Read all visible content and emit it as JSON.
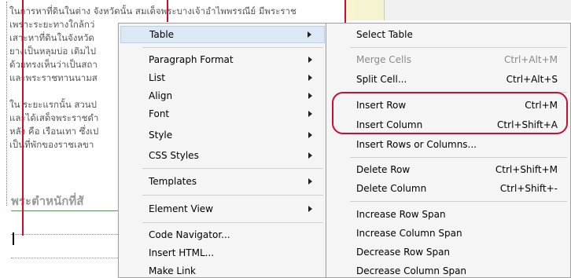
{
  "document": {
    "paragraphs": [
      [
        "ในการหาที่ดินในต่าง จังหวัดนั้น สมเด็จพระบางเจ้าอำไพพรรณีย์ มีพระราช",
        "เพราะระยะทางใกล้กว่",
        "เสาะหาที่ดินในจังหวัด",
        "ยางเป็นหลุมบ่อ เติมไป",
        "ด้วยทรงเห็นว่าเป็นสถา",
        "และพระราชทานนามส"
      ],
      [
        "ใน ระยะแรกนั้น สวนป",
        "และได้เสด็จพระราชดำ",
        "หลัง คือ เรือนเทา ซึ่งเป",
        "เป็นที่พักของราชเลขา"
      ]
    ],
    "heading": "พระตำหนักที่สั"
  },
  "main_menu": {
    "items": [
      {
        "label": "Table",
        "submenu": true,
        "active": true
      },
      {
        "label": "Paragraph Format",
        "submenu": true
      },
      {
        "label": "List",
        "submenu": true
      },
      {
        "label": "Align",
        "submenu": true
      },
      {
        "label": "Font",
        "submenu": true
      },
      {
        "label": "Style",
        "submenu": true
      },
      {
        "label": "CSS Styles",
        "submenu": true
      },
      {
        "label": "Templates",
        "submenu": true
      },
      {
        "label": "Element View",
        "submenu": true
      },
      {
        "label": "Code Navigator...",
        "submenu": false
      },
      {
        "label": "Insert HTML...",
        "submenu": false
      },
      {
        "label": "Make Link",
        "submenu": false
      }
    ]
  },
  "table_submenu": {
    "items": [
      {
        "label": "Select Table",
        "shortcut": ""
      },
      {
        "label": "Merge Cells",
        "shortcut": "Ctrl+Alt+M",
        "disabled": true
      },
      {
        "label": "Split Cell...",
        "shortcut": "Ctrl+Alt+S"
      },
      {
        "label": "Insert Row",
        "shortcut": "Ctrl+M"
      },
      {
        "label": "Insert Column",
        "shortcut": "Ctrl+Shift+A"
      },
      {
        "label": "Insert Rows or Columns...",
        "shortcut": ""
      },
      {
        "label": "Delete Row",
        "shortcut": "Ctrl+Shift+M"
      },
      {
        "label": "Delete Column",
        "shortcut": "Ctrl+Shift+-"
      },
      {
        "label": "Increase Row Span",
        "shortcut": ""
      },
      {
        "label": "Increase Column Span",
        "shortcut": ""
      },
      {
        "label": "Decrease Row Span",
        "shortcut": ""
      },
      {
        "label": "Decrease Column Span",
        "shortcut": ""
      }
    ]
  },
  "colors": {
    "annotation_red": "#c8102e",
    "menu_bg": "#f5f5f5",
    "active_item_bg": "#dde8f6",
    "disabled_text": "#8a8a8a"
  }
}
